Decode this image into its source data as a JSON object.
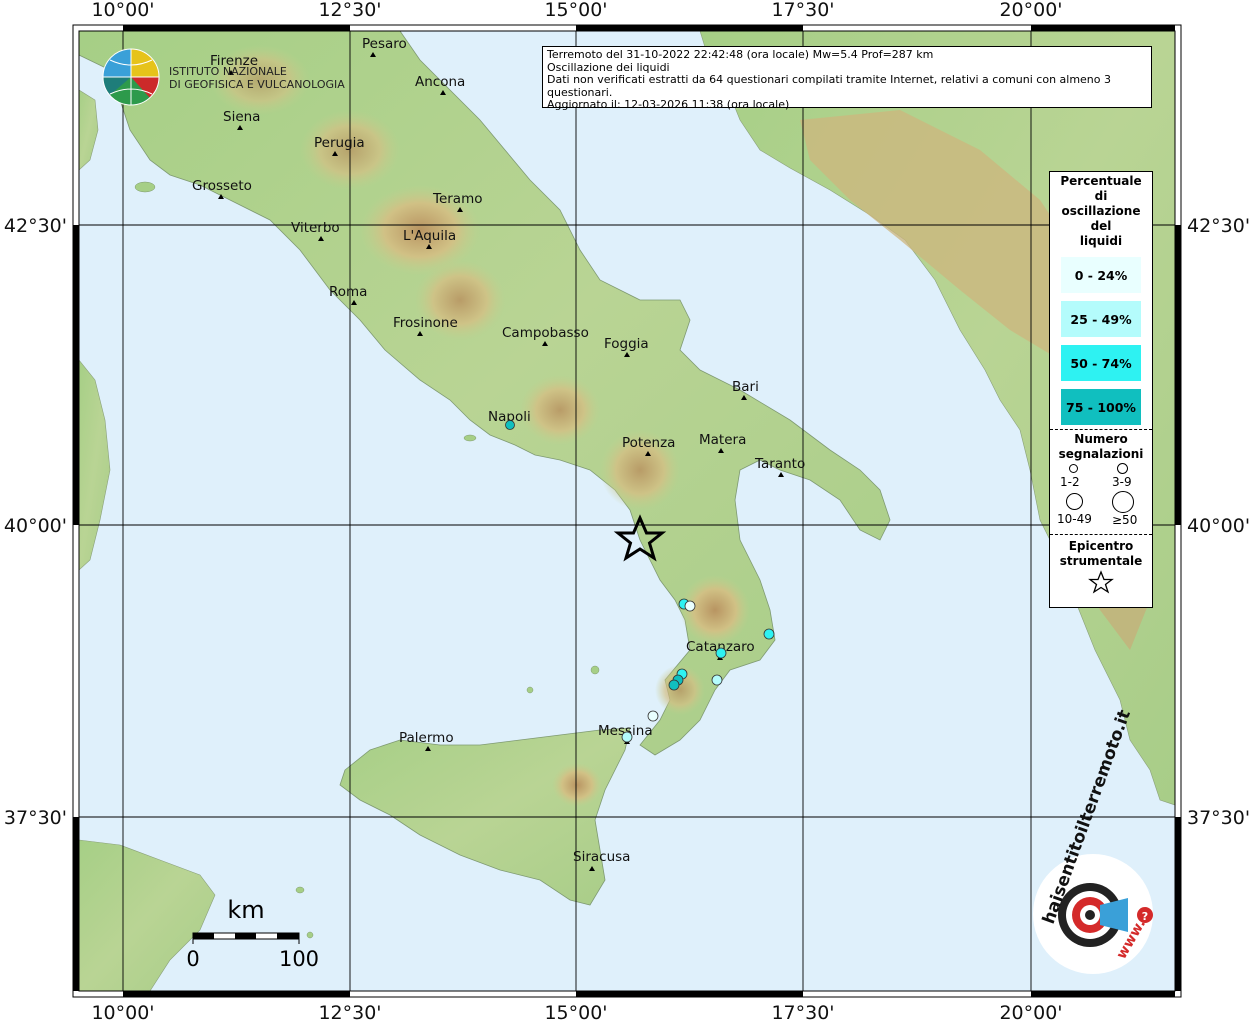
{
  "info": {
    "line1": "Terremoto del 31-10-2022 22:42:48 (ora locale) Mw=5.4 Prof=287 km",
    "line2": "Oscillazione dei liquidi",
    "line3": "Dati non verificati estratti da 64 questionari compilati tramite Internet, relativi a comuni con almeno 3 questionari.",
    "line4": "Aggiornato il: 12-03-2026 11:38 (ora locale)"
  },
  "institute": {
    "line1": "ISTITUTO NAZIONALE",
    "line2": "DI GEOFISICA E VULCANOLOGIA"
  },
  "coords": {
    "top": [
      "10°00'",
      "12°30'",
      "15°00'",
      "17°30'",
      "20°00'"
    ],
    "bottom": [
      "10°00'",
      "12°30'",
      "15°00'",
      "17°30'",
      "20°00'"
    ],
    "left": [
      "42°30'",
      "40°00'",
      "37°30'"
    ],
    "right": [
      "42°30'",
      "40°00'",
      "37°30'"
    ]
  },
  "cities": [
    "Firenze",
    "Pesaro",
    "Ancona",
    "Siena",
    "Perugia",
    "Grosseto",
    "Teramo",
    "Viterbo",
    "L'Aquila",
    "Roma",
    "Frosinone",
    "Campobasso",
    "Foggia",
    "Bari",
    "Napoli",
    "Potenza",
    "Matera",
    "Taranto",
    "Catanzaro",
    "Messina",
    "Palermo",
    "Siracusa"
  ],
  "legend": {
    "title": [
      "Percentuale",
      "di",
      "oscillazione",
      "del",
      "liquidi"
    ],
    "classes": [
      {
        "label": "0 - 24%",
        "color": "#e9ffff"
      },
      {
        "label": "25 - 49%",
        "color": "#b4fcfc"
      },
      {
        "label": "50 - 74%",
        "color": "#2ef2f2"
      },
      {
        "label": "75 - 100%",
        "color": "#10bfbf"
      }
    ],
    "count_title": [
      "Numero",
      "segnalazioni"
    ],
    "count_labels": [
      "1-2",
      "3-9",
      "10-49",
      "≥50"
    ],
    "epicenter_title": [
      "Epicentro",
      "strumentale"
    ]
  },
  "scale": {
    "unit": "km",
    "min": "0",
    "max": "100"
  },
  "brand": {
    "text": "haisentitoilterremoto.it",
    "url": "www.",
    "question": "?"
  },
  "colors": {
    "sea": "#dff0fb",
    "land_low": "#a9cf8c",
    "land_hill": "#d8c48a",
    "land_mountain": "#b58a5a",
    "grid": "#000000"
  }
}
